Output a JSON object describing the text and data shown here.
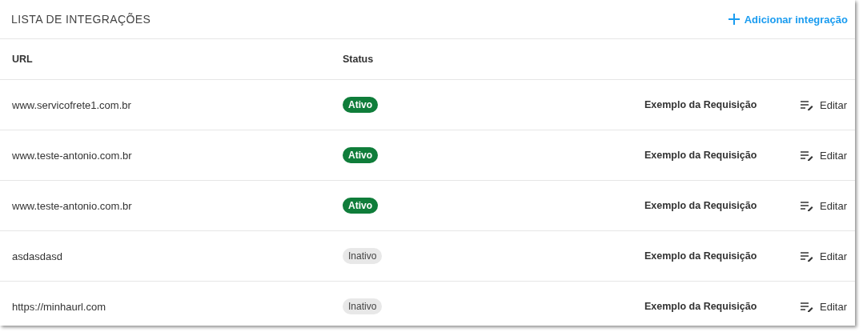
{
  "title": "LISTA DE INTEGRAÇÕES",
  "add_button": "Adicionar integração",
  "table": {
    "columns": [
      "URL",
      "Status"
    ],
    "rows": [
      {
        "url": "www.servicofrete1.com.br",
        "status": "Ativo",
        "active": true,
        "example": "Exemplo da Requisição",
        "edit": "Editar"
      },
      {
        "url": "www.teste-antonio.com.br",
        "status": "Ativo",
        "active": true,
        "example": "Exemplo da Requisição",
        "edit": "Editar"
      },
      {
        "url": "www.teste-antonio.com.br",
        "status": "Ativo",
        "active": true,
        "example": "Exemplo da Requisição",
        "edit": "Editar"
      },
      {
        "url": "asdasdasd",
        "status": "Inativo",
        "active": false,
        "example": "Exemplo da Requisição",
        "edit": "Editar"
      },
      {
        "url": "https://minhaurl.com",
        "status": "Inativo",
        "active": false,
        "example": "Exemplo da Requisição",
        "edit": "Editar"
      }
    ]
  }
}
